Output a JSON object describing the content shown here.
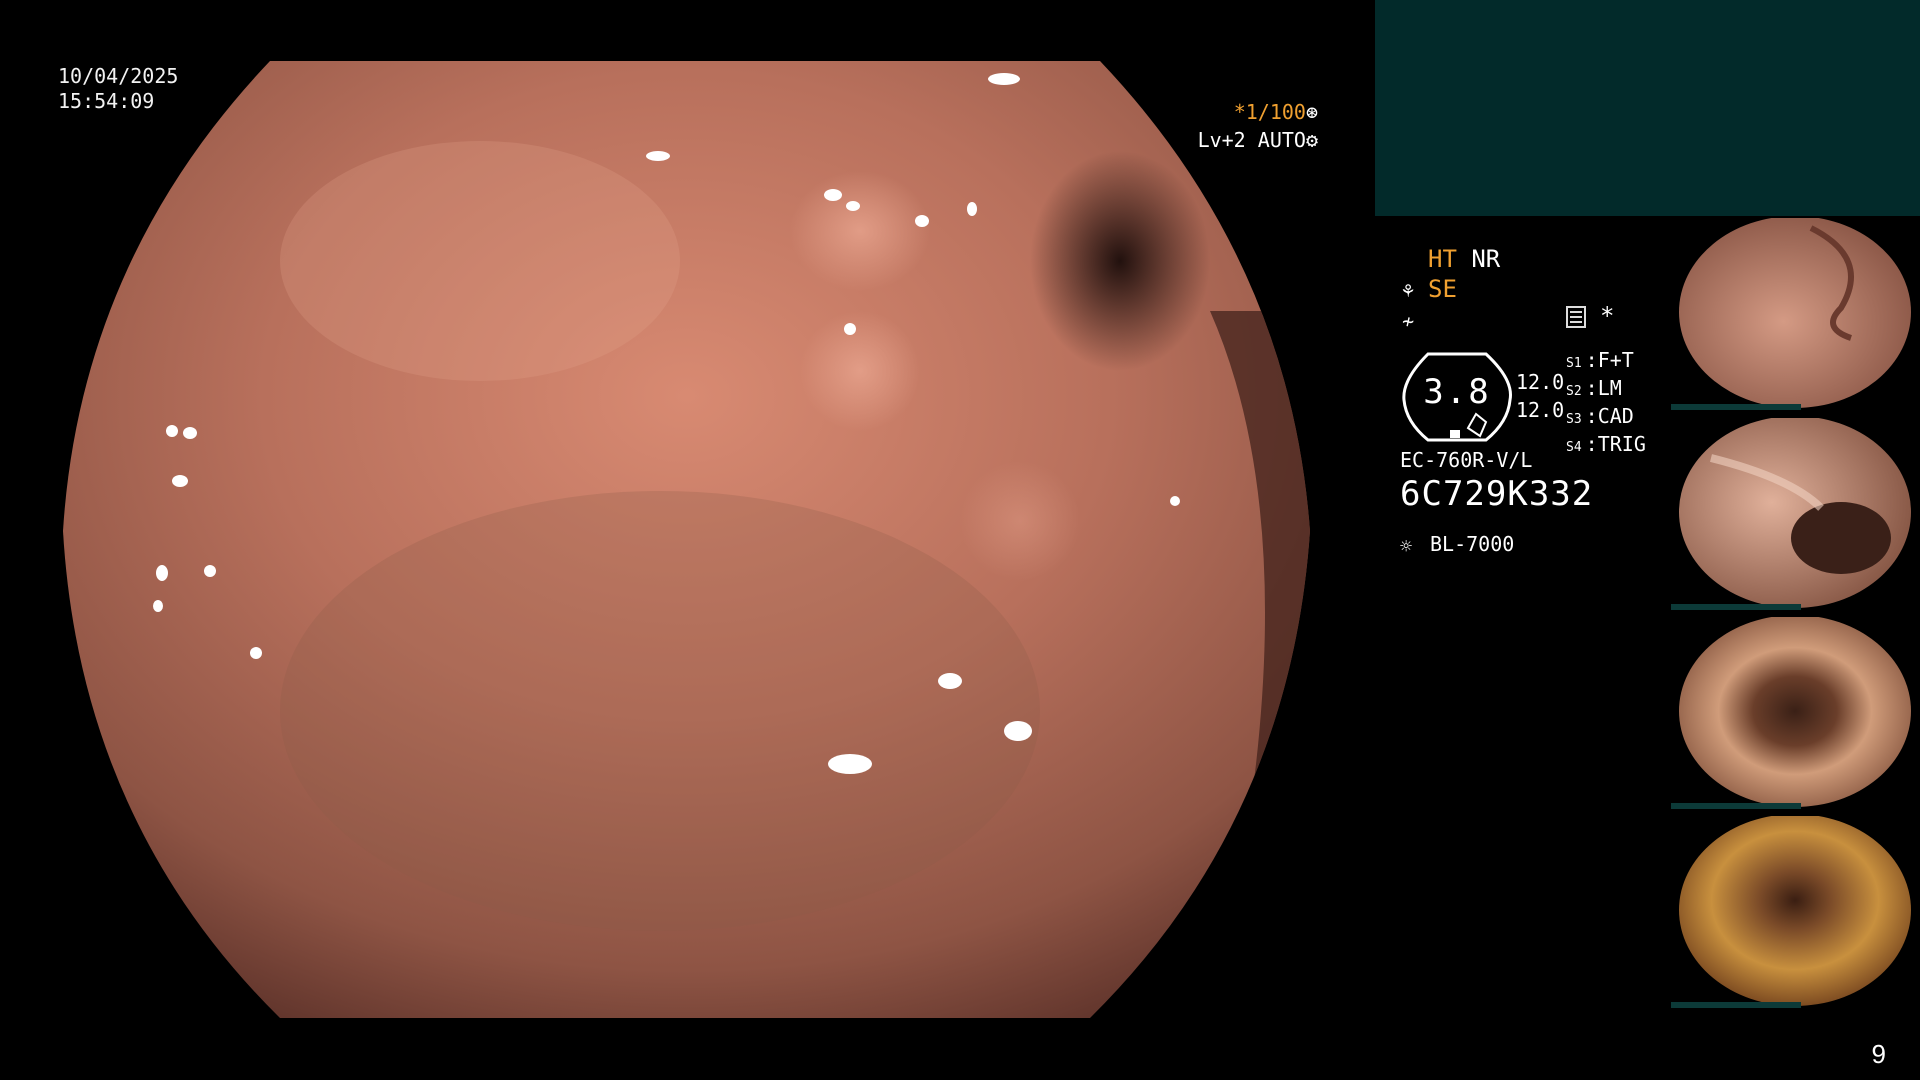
{
  "overlay": {
    "date": "10/04/2025",
    "time": "15:54:09",
    "shutter_speed": "*1/100",
    "level": "Lv+2",
    "auto_label": "AUTO"
  },
  "modes": {
    "ht": "HT",
    "nr": "NR",
    "se": "SE"
  },
  "gauge": {
    "value": "3.8",
    "left_numbers": [
      "12.0",
      "12.0"
    ]
  },
  "scope_switches": [
    {
      "key": "S1",
      "value": "F+T"
    },
    {
      "key": "S2",
      "value": "LM"
    },
    {
      "key": "S3",
      "value": "CAD"
    },
    {
      "key": "S4",
      "value": "TRIG"
    }
  ],
  "device": {
    "model": "EC-760R-V/L",
    "serial": "6C729K332",
    "light_source": "BL-7000"
  },
  "icons": {
    "shutter_icon": "aperture-icon",
    "auto_icon": "gear-icon",
    "light_icon": "sun-icon",
    "memory_icon": "stack-icon",
    "star_icon": "star-icon"
  },
  "colors": {
    "accent": "#f0a030",
    "panel_teal": "#022a2a",
    "text": "#ffffff"
  },
  "page_number": "9"
}
